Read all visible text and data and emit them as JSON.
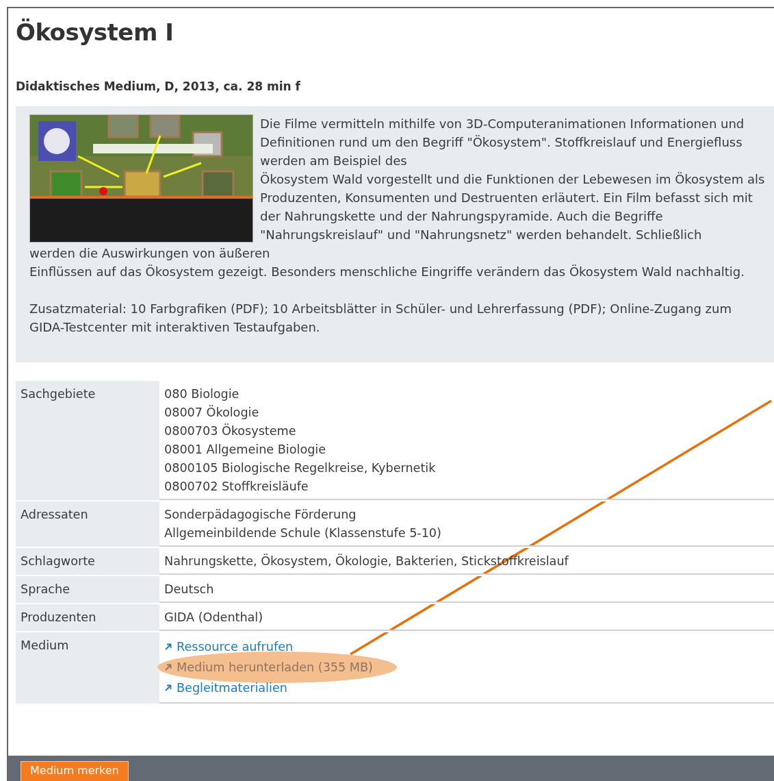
{
  "title": "Ökosystem I",
  "subtitle": "Didaktisches Medium, D, 2013, ca. 28 min f",
  "description": {
    "paragraphs": [
      "Die Filme vermitteln mithilfe von 3D-Computeranimationen Informationen und Definitionen rund um den Begriff \"Ökosystem\". Stoffkreislauf und Energiefluss werden am Beispiel des\nÖkosystem Wald vorgestellt und die Funktionen der Lebewesen im Ökosystem als Produzenten, Konsumenten und Destruenten erläutert. Ein Film befasst sich mit der Nahrungskette und der Nahrungspyramide. Auch die Begriffe \"Nahrungskreislauf\" und \"Nahrungsnetz\" werden behandelt. Schließlich",
      "werden die Auswirkungen von äußeren\nEinflüssen auf das Ökosystem gezeigt. Besonders menschliche Eingriffe verändern das Ökosystem Wald nachhaltig.",
      "Zusatzmaterial: 10 Farbgrafiken (PDF); 10 Arbeitsblätter in Schüler- und Lehrerfassung (PDF); Online-Zugang zum GIDA-Testcenter mit interaktiven Testaufgaben."
    ]
  },
  "details": [
    {
      "label": "Sachgebiete",
      "values": [
        {
          "kind": "text",
          "text": "080 Biologie"
        },
        {
          "kind": "text",
          "text": "08007 Ökologie"
        },
        {
          "kind": "text",
          "text": "0800703 Ökosysteme"
        },
        {
          "kind": "text",
          "text": "08001 Allgemeine Biologie"
        },
        {
          "kind": "text",
          "text": "0800105 Biologische Regelkreise, Kybernetik"
        },
        {
          "kind": "text",
          "text": "0800702 Stoffkreisläufe"
        }
      ]
    },
    {
      "label": "Adressaten",
      "values": [
        {
          "kind": "text",
          "text": "Sonderpädagogische Förderung"
        },
        {
          "kind": "text",
          "text": "Allgemeinbildende Schule (Klassenstufe 5-10)"
        }
      ]
    },
    {
      "label": "Schlagworte",
      "values": [
        {
          "kind": "text",
          "text": "Nahrungskette, Ökosystem, Ökologie, Bakterien, Stickstoffkreislauf"
        }
      ]
    },
    {
      "label": "Sprache",
      "values": [
        {
          "kind": "text",
          "text": "Deutsch"
        }
      ]
    },
    {
      "label": "Produzenten",
      "values": [
        {
          "kind": "text",
          "text": "GIDA (Odenthal)"
        }
      ]
    },
    {
      "label": "Medium",
      "values": [
        {
          "kind": "link",
          "text": "Ressource aufrufen",
          "highlighted": false
        },
        {
          "kind": "link",
          "text": "Medium herunterladen (355 MB)",
          "highlighted": true
        },
        {
          "kind": "link",
          "text": "Begleitmaterialien",
          "highlighted": false
        }
      ]
    }
  ],
  "footer": {
    "buttons": [
      "Medium merken"
    ]
  }
}
